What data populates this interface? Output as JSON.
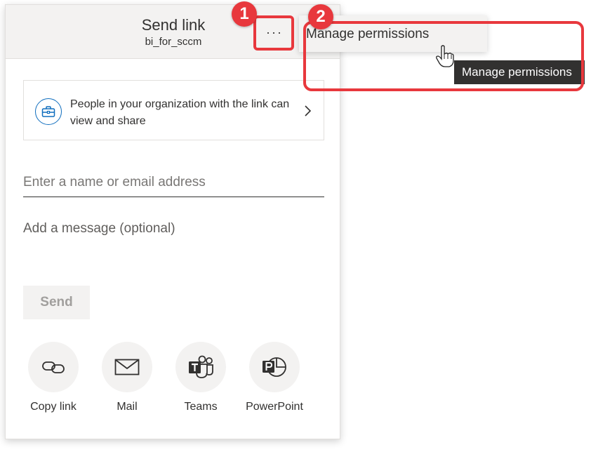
{
  "dialog": {
    "title": "Send link",
    "subtitle": "bi_for_sccm",
    "more_label": "···"
  },
  "link_settings": {
    "text": "People in your organization with the link can view and share",
    "icon": "briefcase-icon"
  },
  "recipient": {
    "placeholder": "Enter a name or email address",
    "value": ""
  },
  "message": {
    "placeholder": "Add a message (optional)",
    "value": ""
  },
  "send_label": "Send",
  "share_options": [
    {
      "label": "Copy link",
      "icon": "link-icon"
    },
    {
      "label": "Mail",
      "icon": "mail-icon"
    },
    {
      "label": "Teams",
      "icon": "teams-icon"
    },
    {
      "label": "PowerPoint",
      "icon": "powerpoint-icon"
    }
  ],
  "menu": {
    "items": [
      {
        "label": "Manage permissions"
      }
    ]
  },
  "tooltip": "Manage permissions",
  "callouts": {
    "step1": "1",
    "step2": "2"
  },
  "colors": {
    "callout": "#e8383d",
    "icon_blue": "#106ebe",
    "header_bg": "#f3f2f1",
    "tooltip_bg": "#323130"
  }
}
